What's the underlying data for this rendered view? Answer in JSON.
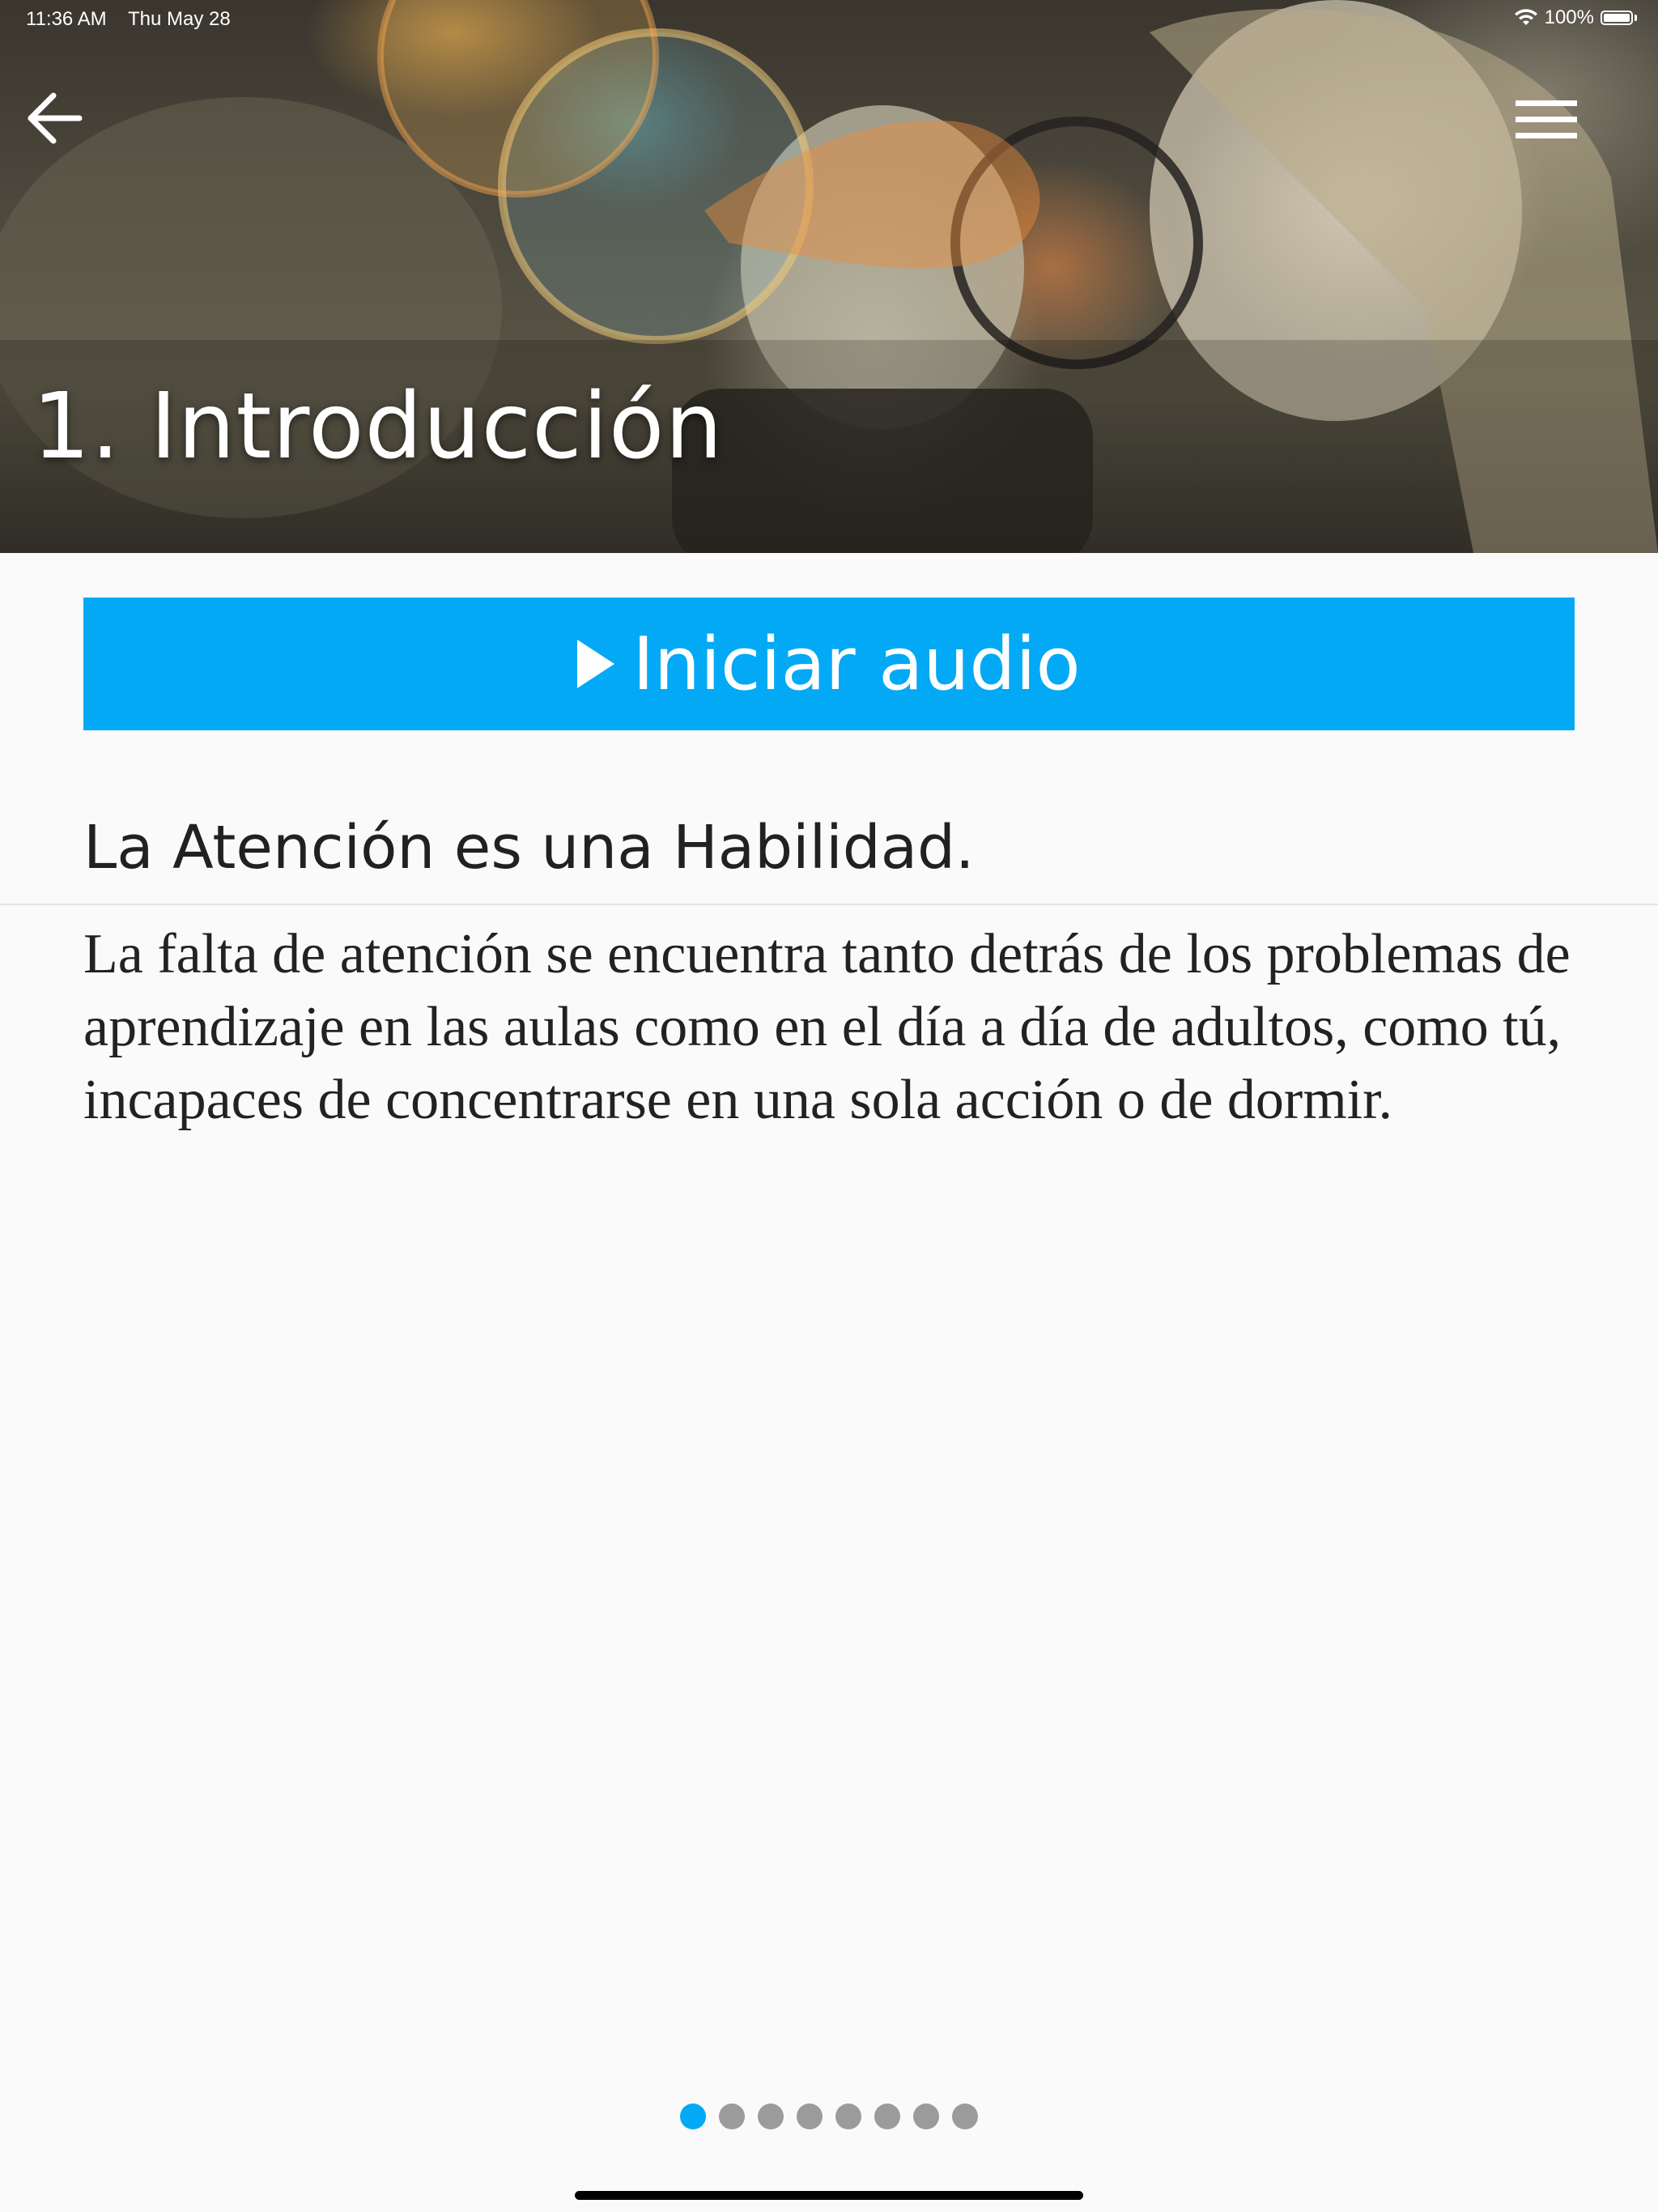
{
  "status_bar": {
    "time": "11:36 AM",
    "date": "Thu May 28",
    "battery": "100%"
  },
  "header": {
    "title": "1. Introducción",
    "back_icon": "arrow-left-icon",
    "menu_icon": "hamburger-menu-icon"
  },
  "audio_button": {
    "label": "Iniciar audio",
    "icon": "play-icon",
    "color": "#03a9f4"
  },
  "content": {
    "heading": "La Atención es una Habilidad.",
    "body": "La falta de atención se encuentra tanto detrás de los problemas de aprendizaje en las aulas como en el día a día de adultos, como tú, incapaces de concentrarse en una sola acción o de dormir."
  },
  "pager": {
    "total": 8,
    "current": 1,
    "active_color": "#03a9f4",
    "inactive_color": "#9b9b9b"
  }
}
